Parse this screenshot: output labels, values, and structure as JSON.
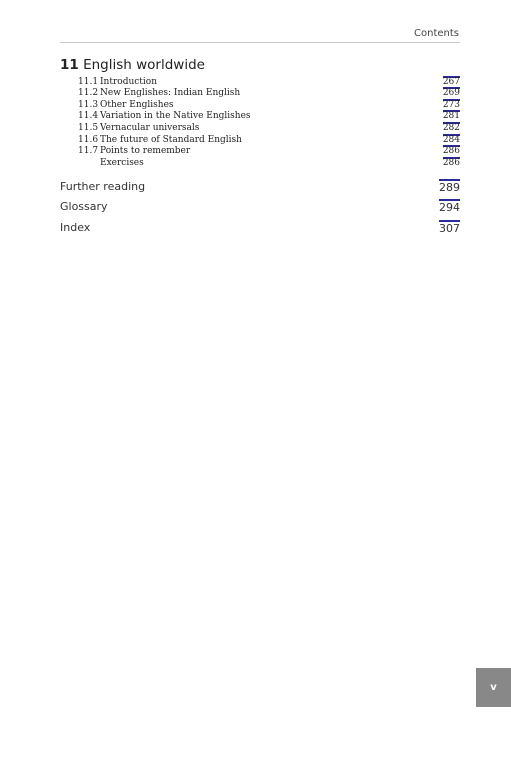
{
  "running_head": "Contents",
  "chapter": {
    "number": "11",
    "title": "English worldwide"
  },
  "sections": [
    {
      "number": "11.1",
      "title": "Introduction",
      "page": "267"
    },
    {
      "number": "11.2",
      "title": "New Englishes: Indian English",
      "page": "269"
    },
    {
      "number": "11.3",
      "title": "Other Englishes",
      "page": "273"
    },
    {
      "number": "11.4",
      "title": "Variation in the Native Englishes",
      "page": "281"
    },
    {
      "number": "11.5",
      "title": "Vernacular universals",
      "page": "282"
    },
    {
      "number": "11.6",
      "title": "The future of Standard English",
      "page": "284"
    },
    {
      "number": "11.7",
      "title": "Points to remember",
      "page": "286"
    },
    {
      "number": "",
      "title": "Exercises",
      "page": "286"
    }
  ],
  "backmatter": [
    {
      "title": "Further reading",
      "page": "289"
    },
    {
      "title": "Glossary",
      "page": "294"
    },
    {
      "title": "Index",
      "page": "307"
    }
  ],
  "folio": "v",
  "link_color": "#2a2a9a"
}
